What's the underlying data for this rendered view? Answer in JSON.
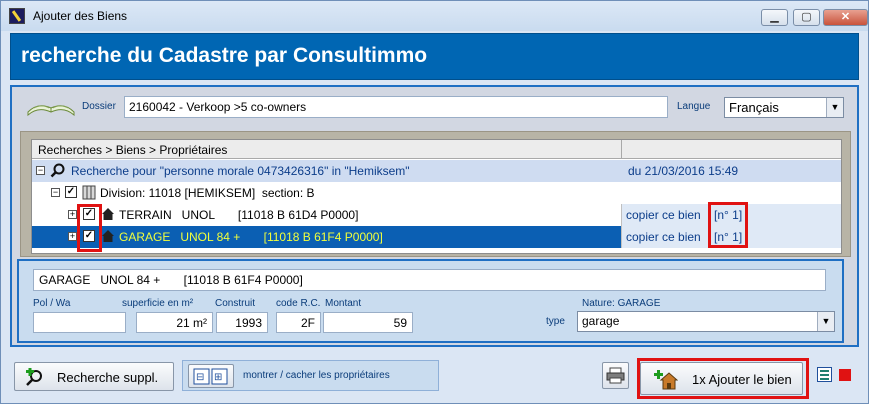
{
  "window": {
    "title": "Ajouter des Biens"
  },
  "header": {
    "title": "recherche du Cadastre par Consultimmo"
  },
  "dossier": {
    "label": "Dossier",
    "value": "2160042 - Verkoop >5 co-owners"
  },
  "langue": {
    "label": "Langue",
    "value": "Français"
  },
  "tree": {
    "header": "Recherches > Biens > Propriétaires",
    "search_row": {
      "text": "Recherche pour \"personne morale 0473426316\" in \"Hemiksem\"",
      "date": "du 21/03/2016 15:49"
    },
    "division_row": {
      "text": "Division: 11018 [HEMIKSEM]  section: B"
    },
    "terrain_row": {
      "text": "TERRAIN   UNOL       [11018 B 61D4 P0000]",
      "copy_label": "copier ce bien",
      "num": "[n° 1]",
      "checked": true
    },
    "garage_row": {
      "text": "GARAGE   UNOL 84 +       [11018 B 61F4 P0000]",
      "copy_label": "copier ce bien",
      "num": "[n° 1]",
      "checked": true
    }
  },
  "details": {
    "description": "GARAGE   UNOL 84 +       [11018 B 61F4 P0000]",
    "pol_label": "Pol / Wa",
    "superficie_label": "superficie en m²",
    "construit_label": "Construit",
    "code_label": "code R.C.",
    "montant_label": "Montant",
    "nature_label": "Nature: GARAGE",
    "type_label": "type",
    "pol_value": "",
    "superficie_value": "21 m²",
    "construit_value": "1993",
    "code_value": "2F",
    "montant_value": "59",
    "type_value": "garage"
  },
  "footer": {
    "recherche_label": "Recherche suppl.",
    "toggle_label": "montrer / cacher les propriétaires",
    "add_label": "1x Ajouter le bien"
  },
  "colors": {
    "accent": "#0066b3",
    "highlight": "#e01212",
    "selected_text": "#f2ff3c"
  }
}
